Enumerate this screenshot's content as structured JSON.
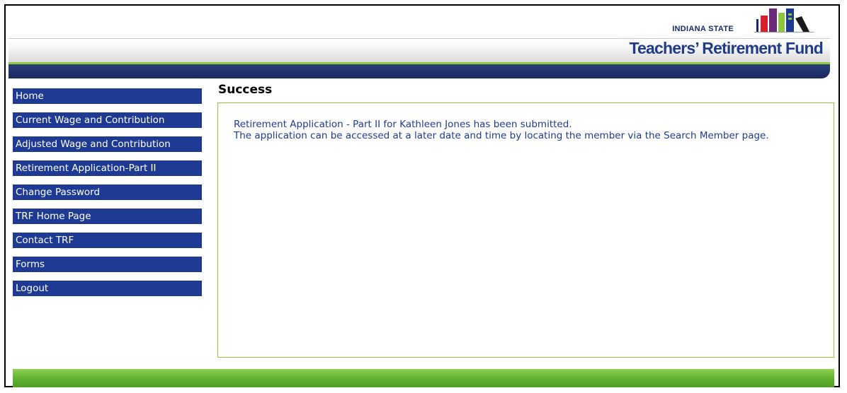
{
  "header": {
    "logo_state": "INDIANA STATE",
    "logo_fund": "Teachers’ Retirement Fund"
  },
  "nav": {
    "items": [
      {
        "label": "Home"
      },
      {
        "label": "Current Wage and Contribution"
      },
      {
        "label": "Adjusted Wage and Contribution"
      },
      {
        "label": "Retirement Application-Part II"
      },
      {
        "label": "Change Password"
      },
      {
        "label": "TRF Home Page"
      },
      {
        "label": "Contact TRF"
      },
      {
        "label": "Forms"
      },
      {
        "label": "Logout"
      }
    ]
  },
  "main": {
    "title": "Success",
    "message_line1": "Retirement Application - Part II for Kathleen Jones has been submitted.",
    "message_line2": "The application can be accessed at a later date and time by locating the member via the Search Member page."
  },
  "colors": {
    "nav_bg": "#1f3a93",
    "accent_green": "#8dc63f",
    "text_blue": "#1f3a93"
  }
}
